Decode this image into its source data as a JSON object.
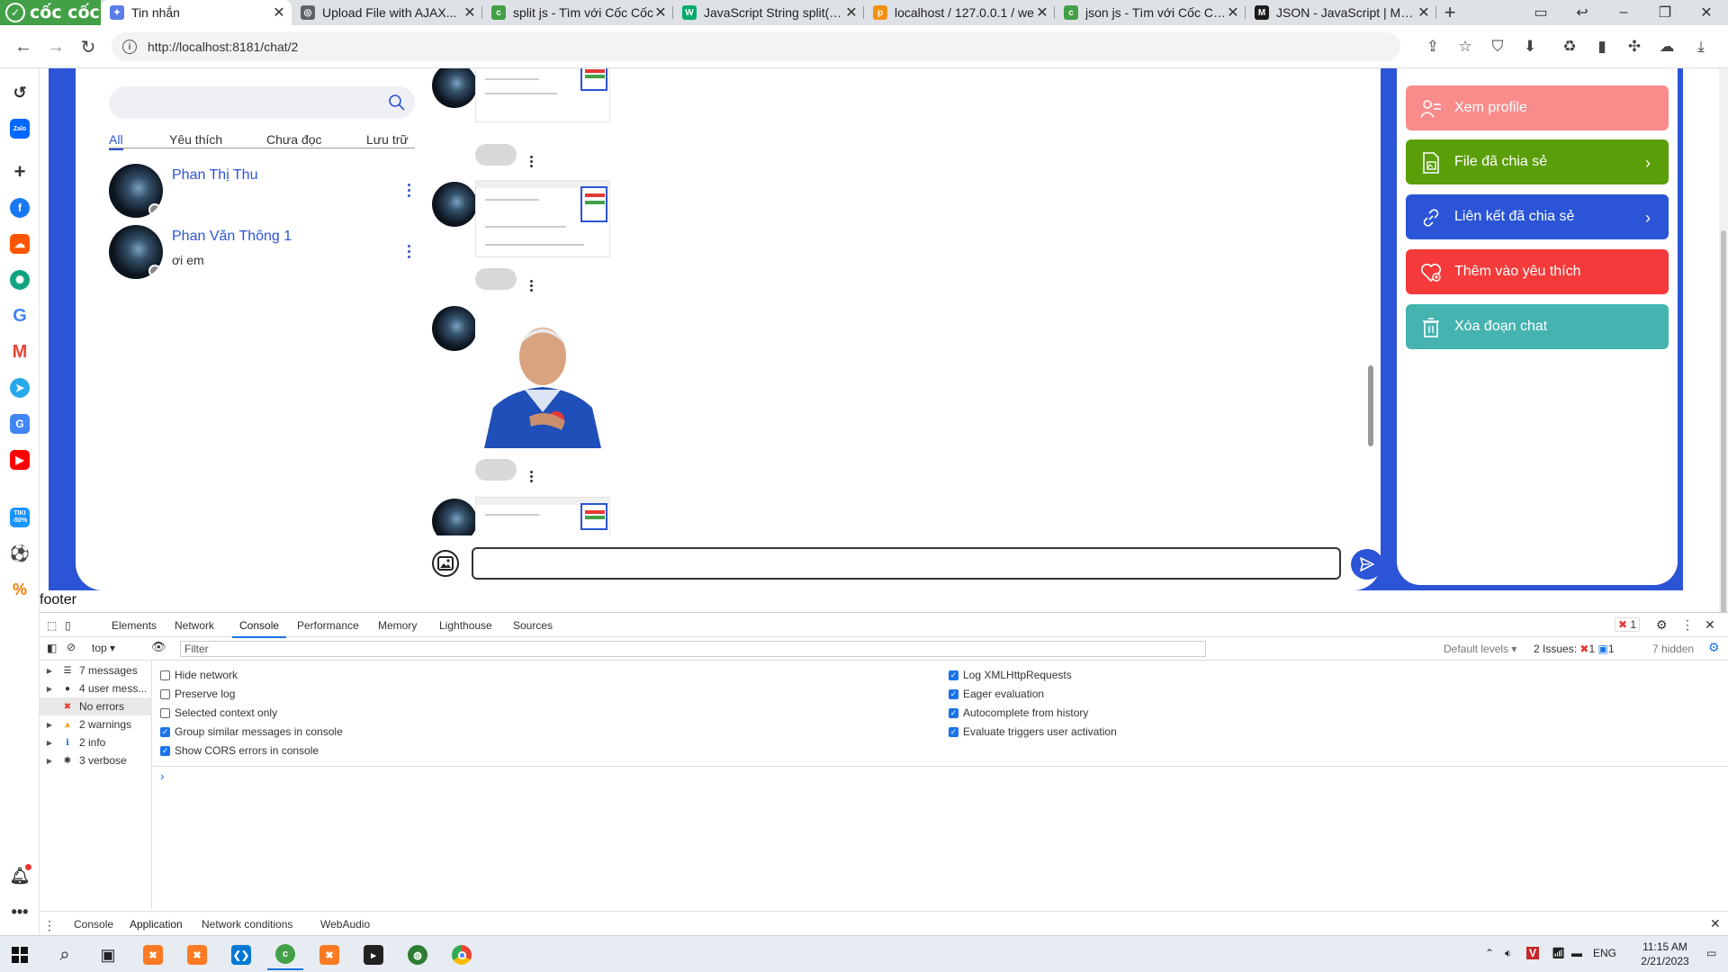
{
  "browser": {
    "brand": "cốc cốc",
    "tabs": [
      {
        "title": "Tin nhắn",
        "icon": "chat-app-icon",
        "color": "#5a7de8",
        "active": true
      },
      {
        "title": "Upload File with AJAX...",
        "icon": "globe-icon",
        "color": "#5f6368",
        "active": false
      },
      {
        "title": "split js - Tìm với Cốc Cốc",
        "icon": "coccoc-icon",
        "color": "#43a047",
        "active": false
      },
      {
        "title": "JavaScript String split() M",
        "icon": "w3schools-icon",
        "color": "#04aa6d",
        "active": false
      },
      {
        "title": "localhost / 127.0.0.1 / we",
        "icon": "phpmyadmin-icon",
        "color": "#f29111",
        "active": false
      },
      {
        "title": "json js - Tìm với Cốc Cốc",
        "icon": "coccoc-icon",
        "color": "#43a047",
        "active": false
      },
      {
        "title": "JSON - JavaScript | MDN",
        "icon": "mdn-icon",
        "color": "#1b1b1b",
        "active": false
      }
    ],
    "url": "http://localhost:8181/chat/2"
  },
  "sidebar_icons": [
    "history-icon",
    "zalo-icon",
    "add-icon",
    "facebook-icon",
    "soundcloud-icon",
    "chatgpt-icon",
    "google-icon",
    "gmail-icon",
    "telegram-icon",
    "translate-icon",
    "youtube-icon",
    "tiki-icon",
    "football-icon",
    "coupon-icon",
    "notification-icon",
    "more-icon"
  ],
  "sidebar_texts": {
    "zalo": "Zalo",
    "tiki": "TIKI -50%"
  },
  "chat": {
    "search_placeholder": "",
    "filter_tabs": [
      "All",
      "Yêu thích",
      "Chưa đọc",
      "Lưu trữ"
    ],
    "contacts": [
      {
        "name": "Phan Thị Thu",
        "last_message": ""
      },
      {
        "name": "Phan Văn Thông 1",
        "last_message": "ơi em"
      }
    ],
    "composer_value": ""
  },
  "actions": [
    {
      "label": "Xem profile",
      "color": "#f98b8b",
      "icon": "user-list-icon",
      "chevron": false
    },
    {
      "label": "File đã chia sẻ",
      "color": "#5a9e0a",
      "icon": "file-image-icon",
      "chevron": true
    },
    {
      "label": "Liên kết đã chia sẻ",
      "color": "#2b54d6",
      "icon": "link-icon",
      "chevron": true
    },
    {
      "label": "Thêm vào yêu thích",
      "color": "#f43a3a",
      "icon": "heart-icon",
      "chevron": false
    },
    {
      "label": "Xóa đoạn chat",
      "color": "#45b3b0",
      "icon": "trash-icon",
      "chevron": false
    }
  ],
  "footer_text": "footer",
  "devtools": {
    "tabs": [
      "Elements",
      "Network",
      "Console",
      "Performance",
      "Memory",
      "Lighthouse",
      "Sources"
    ],
    "active_tab": "Console",
    "error_badge": "1",
    "context": "top",
    "filter_placeholder": "Filter",
    "levels": "Default levels",
    "issues_label": "2 Issues:",
    "issues_errors": "1",
    "issues_info": "1",
    "hidden": "7 hidden",
    "sidebar": [
      {
        "label": "7 messages",
        "icon": "list-icon"
      },
      {
        "label": "4 user mess...",
        "icon": "user-icon"
      },
      {
        "label": "No errors",
        "icon": "error-icon"
      },
      {
        "label": "2 warnings",
        "icon": "warning-icon"
      },
      {
        "label": "2 info",
        "icon": "info-icon"
      },
      {
        "label": "3 verbose",
        "icon": "bug-icon"
      }
    ],
    "options_left": [
      {
        "label": "Hide network",
        "checked": false
      },
      {
        "label": "Preserve log",
        "checked": false
      },
      {
        "label": "Selected context only",
        "checked": false
      },
      {
        "label": "Group similar messages in console",
        "checked": true
      },
      {
        "label": "Show CORS errors in console",
        "checked": true
      }
    ],
    "options_right": [
      {
        "label": "Log XMLHttpRequests",
        "checked": true
      },
      {
        "label": "Eager evaluation",
        "checked": true
      },
      {
        "label": "Autocomplete from history",
        "checked": true
      },
      {
        "label": "Evaluate triggers user activation",
        "checked": true
      }
    ],
    "prompt": "›",
    "drawer_tabs": [
      "Console",
      "Application",
      "Network conditions",
      "WebAudio"
    ],
    "drawer_active": "Application"
  },
  "taskbar": {
    "lang": "ENG",
    "time": "11:15 AM",
    "date": "2/21/2023"
  }
}
